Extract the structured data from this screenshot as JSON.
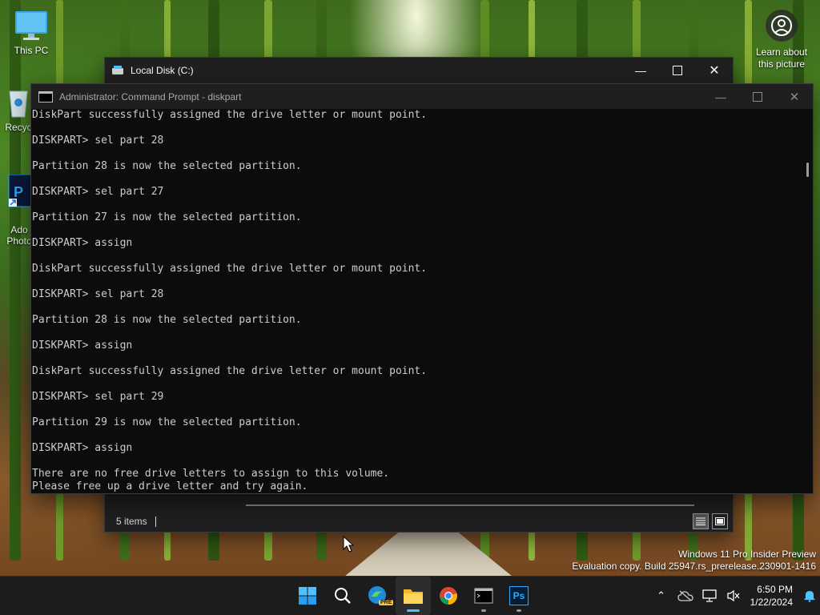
{
  "desktop": {
    "icons": [
      {
        "label": "This PC"
      },
      {
        "label": "Recyc"
      },
      {
        "label": "Ado\nPhoto"
      }
    ],
    "learn_about": "Learn about\nthis picture"
  },
  "explorer": {
    "title": "Local Disk (C:)",
    "status_count": "5 items"
  },
  "cmd": {
    "title": "Administrator: Command Prompt - diskpart",
    "lines": [
      "DiskPart successfully assigned the drive letter or mount point.",
      "",
      "DISKPART> sel part 28",
      "",
      "Partition 28 is now the selected partition.",
      "",
      "DISKPART> sel part 27",
      "",
      "Partition 27 is now the selected partition.",
      "",
      "DISKPART> assign",
      "",
      "DiskPart successfully assigned the drive letter or mount point.",
      "",
      "DISKPART> sel part 28",
      "",
      "Partition 28 is now the selected partition.",
      "",
      "DISKPART> assign",
      "",
      "DiskPart successfully assigned the drive letter or mount point.",
      "",
      "DISKPART> sel part 29",
      "",
      "Partition 29 is now the selected partition.",
      "",
      "DISKPART> assign",
      "",
      "There are no free drive letters to assign to this volume.",
      "Please free up a drive letter and try again."
    ]
  },
  "watermark": {
    "line1": "Windows 11 Pro Insider Preview",
    "line2": "Evaluation copy. Build 25947.rs_prerelease.230901-1416"
  },
  "taskbar": {
    "edge_badge": "PRE",
    "photoshop_label": "Ps",
    "time": "6:50 PM",
    "date": "1/22/2024"
  },
  "colors": {
    "accent": "#4cc2ff",
    "console_bg": "#0c0c0c",
    "console_text": "#cccccc",
    "taskbar_bg": "#1c1c1c"
  }
}
